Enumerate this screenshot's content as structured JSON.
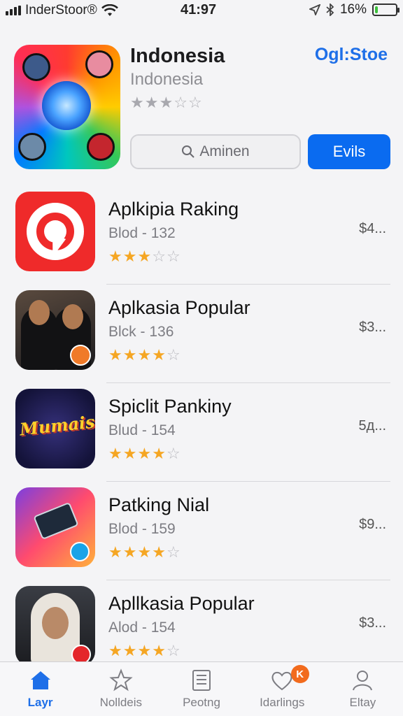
{
  "status_bar": {
    "carrier": "InderStoor®",
    "time": "41:97",
    "battery": "16%",
    "battery_level": 0.16
  },
  "featured": {
    "title": "Indonesia",
    "subtitle": "Indonesia",
    "rating": 3,
    "link": "Ogl:Stoe",
    "search_placeholder": "Aminen",
    "action_label": "Evils"
  },
  "apps": [
    {
      "name": "Aplkipia Raking",
      "meta": "Blod - 132",
      "price": "$4...",
      "rating": 2.5,
      "icon": "target-icon"
    },
    {
      "name": "Aplkasia Popular",
      "meta": "Blck - 136",
      "price": "$3...",
      "rating": 3.5,
      "icon": "people-icon"
    },
    {
      "name": "Spiclit Pankiny",
      "meta": "Blud - 154",
      "price": "5д...",
      "rating": 3.5,
      "icon": "wordmark-icon"
    },
    {
      "name": "Patking Nial",
      "meta": "Blod - 159",
      "price": "$9...",
      "rating": 3.5,
      "icon": "phone-icon"
    },
    {
      "name": "Apllkasia Popular",
      "meta": "Alod - 154",
      "price": "$3...",
      "rating": 3.5,
      "icon": "portrait-icon"
    }
  ],
  "icon_text": {
    "wordmark": "Mumais"
  },
  "tabs": [
    {
      "label": "Layr",
      "icon": "home-icon",
      "active": true
    },
    {
      "label": "Nolldeis",
      "icon": "star-icon",
      "active": false
    },
    {
      "label": "Peotng",
      "icon": "list-icon",
      "active": false
    },
    {
      "label": "Idarlings",
      "icon": "heart-icon",
      "active": false,
      "badge": "K"
    },
    {
      "label": "Eltay",
      "icon": "person-icon",
      "active": false
    }
  ],
  "colors": {
    "accent": "#0a6bf0",
    "star": "#f5a623",
    "badge": "#f26b1d"
  }
}
